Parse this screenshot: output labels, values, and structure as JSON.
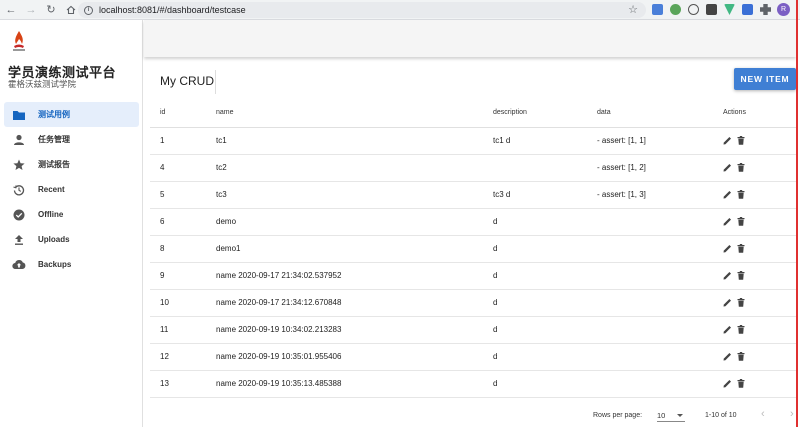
{
  "browser": {
    "url": "localhost:8081/#/dashboard/testcase",
    "profile_initial": "R"
  },
  "app": {
    "title": "学员演练测试平台",
    "subtitle": "霍格沃兹测试学院"
  },
  "sidebar": {
    "items": [
      {
        "label": "测试用例",
        "icon": "folder-icon",
        "active": true
      },
      {
        "label": "任务管理",
        "icon": "account-icon",
        "active": false
      },
      {
        "label": "测试报告",
        "icon": "star-icon",
        "active": false
      },
      {
        "label": "Recent",
        "icon": "history-icon",
        "active": false
      },
      {
        "label": "Offline",
        "icon": "check-circle-icon",
        "active": false
      },
      {
        "label": "Uploads",
        "icon": "upload-icon",
        "active": false
      },
      {
        "label": "Backups",
        "icon": "cloud-upload-icon",
        "active": false
      }
    ]
  },
  "card": {
    "title": "My CRUD",
    "new_button": "NEW ITEM"
  },
  "table": {
    "headers": {
      "id": "id",
      "name": "name",
      "description": "description",
      "data": "data",
      "actions": "Actions"
    },
    "rows": [
      {
        "id": "1",
        "name": "tc1",
        "description": "tc1 d",
        "data": "- assert: [1, 1]"
      },
      {
        "id": "4",
        "name": "tc2",
        "description": "",
        "data": "- assert: [1, 2]"
      },
      {
        "id": "5",
        "name": "tc3",
        "description": "tc3 d",
        "data": "- assert: [1, 3]"
      },
      {
        "id": "6",
        "name": "demo",
        "description": "d",
        "data": ""
      },
      {
        "id": "8",
        "name": "demo1",
        "description": "d",
        "data": ""
      },
      {
        "id": "9",
        "name": "name 2020-09-17 21:34:02.537952",
        "description": "d",
        "data": ""
      },
      {
        "id": "10",
        "name": "name 2020-09-17 21:34:12.670848",
        "description": "d",
        "data": ""
      },
      {
        "id": "11",
        "name": "name 2020-09-19 10:34:02.213283",
        "description": "d",
        "data": ""
      },
      {
        "id": "12",
        "name": "name 2020-09-19 10:35:01.955406",
        "description": "d",
        "data": ""
      },
      {
        "id": "13",
        "name": "name 2020-09-19 10:35:13.485388",
        "description": "d",
        "data": ""
      }
    ]
  },
  "pagination": {
    "rows_per_page_label": "Rows per page:",
    "rows_per_page": "10",
    "range": "1-10 of 10"
  },
  "colors": {
    "primary": "#3f7fd4",
    "active_bg": "#e5eefb",
    "active_text": "#1565c0"
  }
}
